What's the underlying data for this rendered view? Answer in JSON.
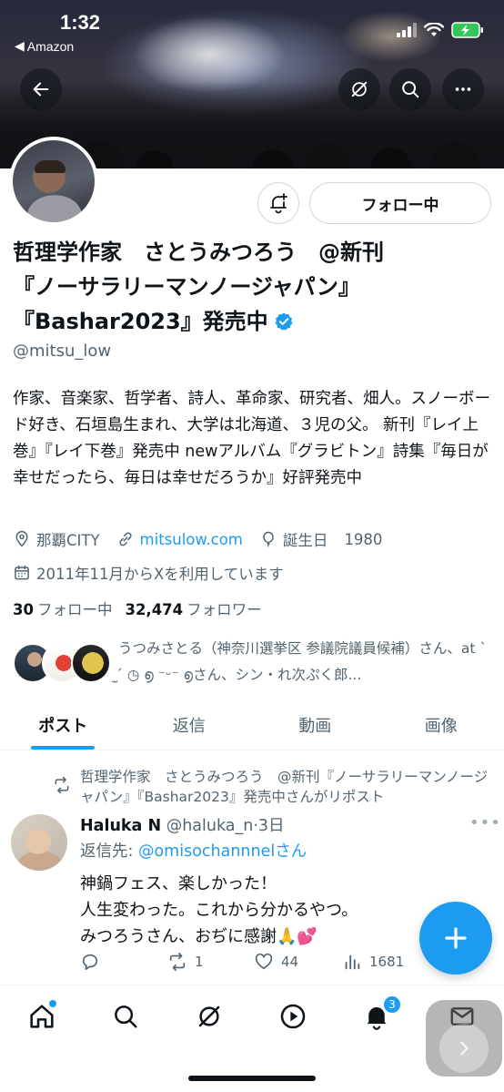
{
  "status_bar": {
    "time": "1:32",
    "back_app": "Amazon"
  },
  "profile": {
    "display_name_line1": "哲理学作家　さとうみつろう　@新刊",
    "display_name_line2": "『ノーサラリーマンノージャパン』",
    "display_name_line3": "『Bashar2023』発売中",
    "handle": "@mitsu_low",
    "follow_button_label": "フォロー中",
    "bio": "作家、音楽家、哲学者、詩人、革命家、研究者、畑人。スノーボード好き、石垣島生まれ、大学は北海道、３児の父。 新刊『レイ上巻』『レイ下巻』発売中 newアルバム『グラビトン』詩集『毎日が幸せだったら、毎日は幸せだろうか』好評発売中",
    "location": "那覇CITY",
    "website": "mitsulow.com",
    "birthday_label": "誕生日",
    "birthday_year": "1980",
    "joined": "2011年11月からXを利用しています",
    "following_count": "30",
    "following_label": "フォロー中",
    "followers_count": "32,474",
    "followers_label": "フォロワー",
    "followers_you_know": "うつみさとる（神奈川選挙区 参議院議員候補）さん、at ˋ ̫ ́ ◷ ൭ ⁻ᵕ⁻ ൭さん、シン・れ次ぷく郎..."
  },
  "tabs": [
    {
      "label": "ポスト",
      "active": true
    },
    {
      "label": "返信",
      "active": false
    },
    {
      "label": "動画",
      "active": false
    },
    {
      "label": "画像",
      "active": false
    }
  ],
  "tweet": {
    "repost_text": "哲理学作家　さとうみつろう　@新刊『ノーサラリーマンノージャパン』『Bashar2023』発売中さんがリポスト",
    "author_name": "Haluka N",
    "author_handle": "@haluka_n",
    "time": "·3日",
    "reply_prefix": "返信先: ",
    "reply_to": "@omisochannnelさん",
    "text": "神鍋フェス、楽しかった！\n人生変わった。これから分かるやつ。\nみつろうさん、おぢに感謝🙏💕",
    "reposts": "1",
    "likes": "44",
    "views": "1681"
  },
  "bottom_nav": {
    "notifications_badge": "3"
  },
  "colors": {
    "accent": "#1d9bf0",
    "text_primary": "#0f1419",
    "text_secondary": "#536471",
    "border": "#cfd9de"
  }
}
